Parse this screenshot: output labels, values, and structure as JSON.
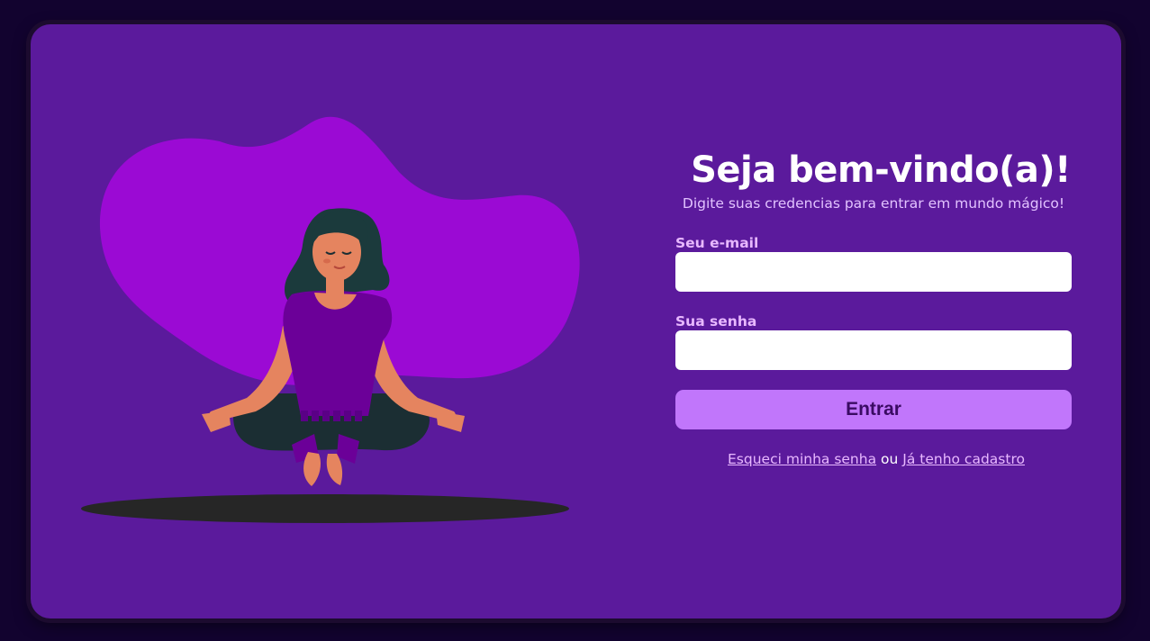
{
  "login": {
    "title": "Seja bem-vindo(a)!",
    "subtitle": "Digite suas credencias para entrar em mundo mágico!",
    "email_label": "Seu e-mail",
    "email_value": "",
    "password_label": "Sua senha",
    "password_value": "",
    "submit_label": "Entrar",
    "forgot_link": "Esqueci minha senha",
    "separator": "ou",
    "register_link": "Já tenho cadastro"
  },
  "illustration": {
    "subject": "meditating woman floating over a purple blob"
  },
  "colors": {
    "page_background": "#12032f",
    "card_background": "#5b1a9c",
    "blob": "#9b0ad4",
    "button": "#c176fb",
    "label": "#e8b8ff",
    "shadow": "#262626"
  }
}
